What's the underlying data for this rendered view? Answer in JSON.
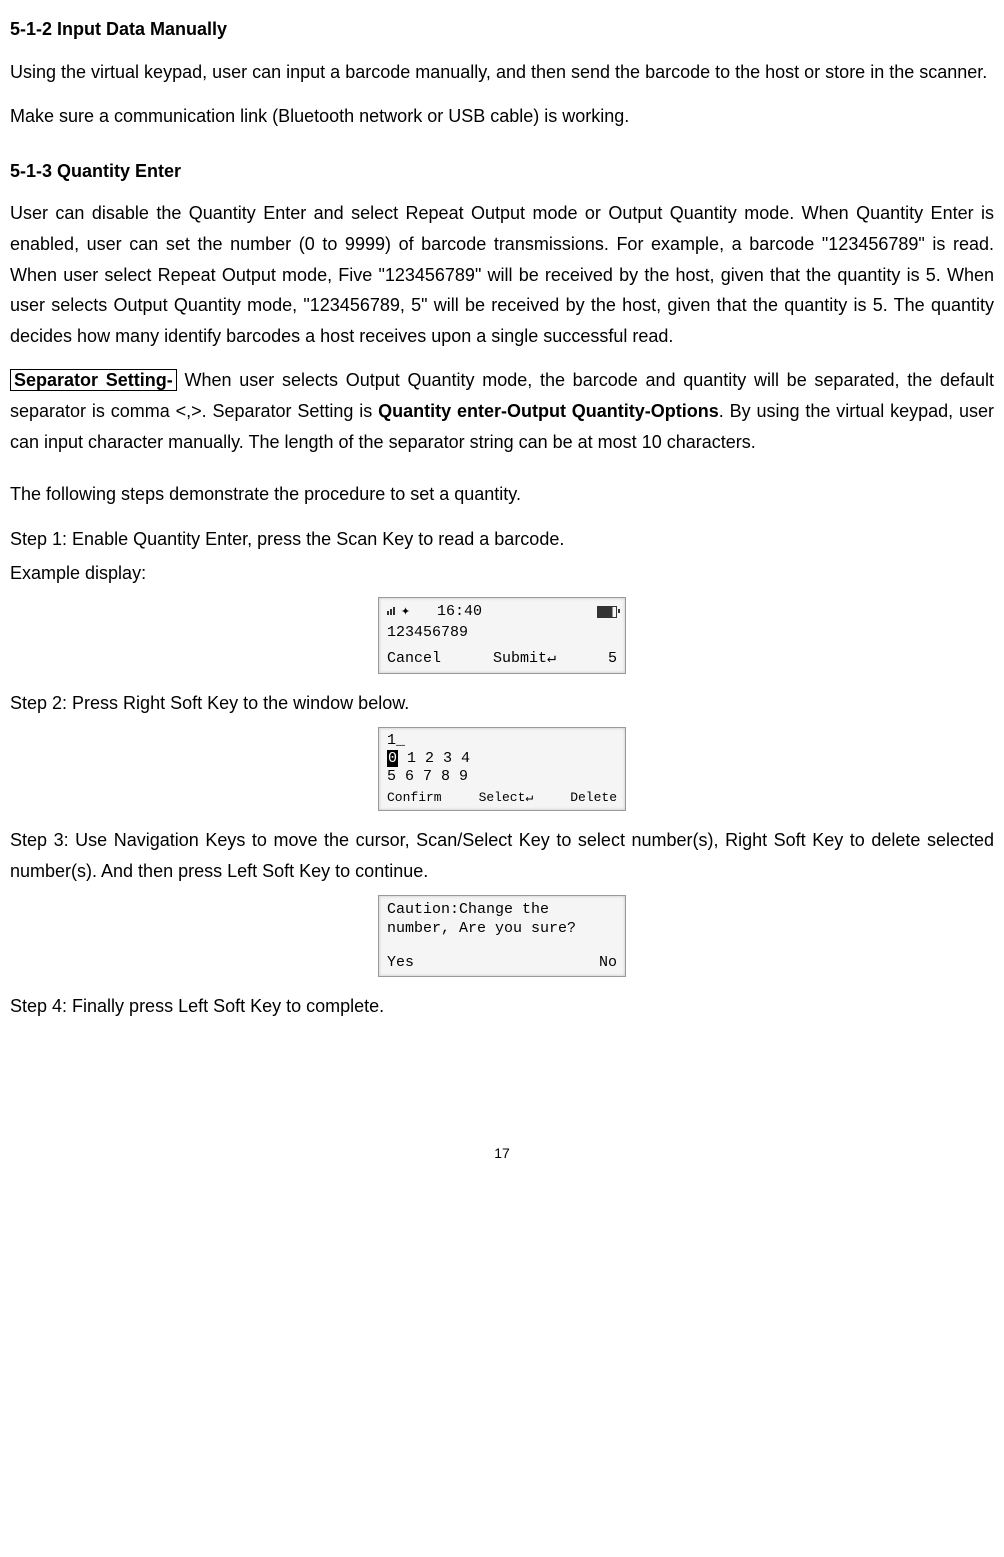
{
  "section_1": {
    "heading": "5-1-2 Input Data Manually",
    "para1": "Using the virtual keypad, user can input a barcode manually, and then send the barcode to the host or store in the scanner.",
    "para2": "Make sure a communication link (Bluetooth network or USB cable) is working."
  },
  "section_2": {
    "heading": "5-1-3 Quantity Enter",
    "para1": "User can disable the Quantity Enter and select Repeat Output mode or Output Quantity mode. When Quantity Enter is enabled, user can set the number (0 to 9999) of barcode transmissions. For example, a barcode \"123456789\" is read. When user select Repeat Output mode, Five \"123456789\" will be received by the host, given that the quantity is 5. When user selects Output Quantity mode, \"123456789, 5\" will be received by the host, given that the quantity is 5. The quantity decides how many identify barcodes a host receives upon a single successful read.",
    "sep_label": "Separator Setting-",
    "sep_text_1": " When user selects Output Quantity mode, the barcode and quantity will be separated, the default separator is comma <,>. Separator Setting is ",
    "sep_bold": "Quantity enter-Output Quantity-Options",
    "sep_text_2": ". By using the virtual keypad, user can input character manually. The length of the separator string can be at most 10 characters.",
    "para3": "The following steps demonstrate the procedure to set a quantity.",
    "step1": "Step 1: Enable Quantity Enter, press the Scan Key to read a barcode.",
    "example_label": "Example display:",
    "step2": "Step 2: Press Right Soft Key to the window below.",
    "step3": "Step 3: Use Navigation Keys to move the cursor, Scan/Select Key to select number(s), Right Soft Key to delete selected number(s). And then press Left Soft Key to continue.",
    "step4": "Step 4: Finally press Left Soft Key to complete."
  },
  "lcd1": {
    "time": "16:40",
    "body": "123456789",
    "left": "Cancel",
    "mid": "Submit↵",
    "right": "5"
  },
  "lcd2": {
    "line0": "1_",
    "cell0": "0",
    "line1_rest": " 1 2 3 4",
    "line2": "5 6 7 8 9",
    "left": "Confirm",
    "mid": "Select↵",
    "right": "Delete"
  },
  "lcd3": {
    "line1": "Caution:Change the",
    "line2": "number, Are you sure?",
    "left": "Yes",
    "right": "No"
  },
  "page": "17"
}
